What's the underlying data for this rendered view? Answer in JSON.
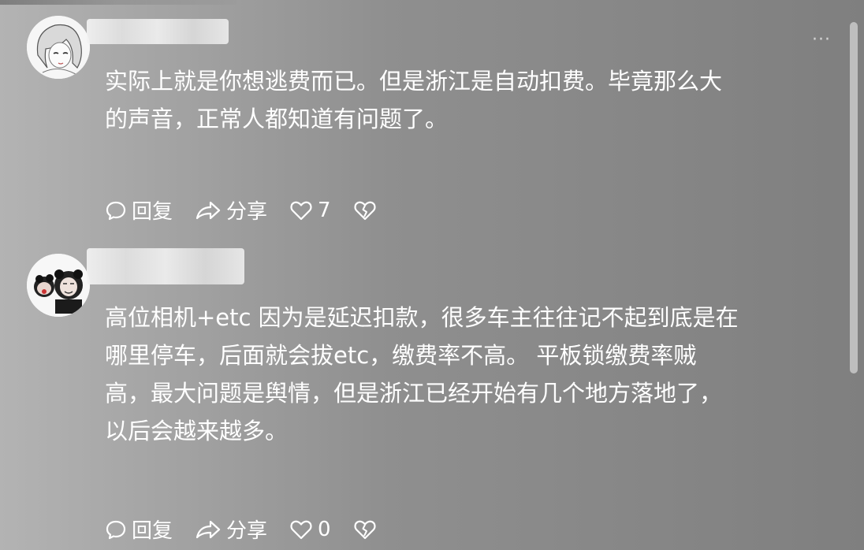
{
  "comments": [
    {
      "lines": [
        "实际上就是你想逃费而已。但是浙江是自动扣费。毕竟那么大",
        "的声音，正常人都知道有问题了。"
      ],
      "reply_label": "回复",
      "share_label": "分享",
      "like_count": "7"
    },
    {
      "lines": [
        "高位相机+etc 因为是延迟扣款，很多车主往往记不起到底是在",
        "哪里停车，后面就会拔etc，缴费率不高。 平板锁缴费率贼",
        "高，最大问题是舆情，但是浙江已经开始有几个地方落地了，",
        "以后会越来越多。"
      ],
      "reply_label": "回复",
      "share_label": "分享",
      "like_count": "0"
    }
  ],
  "icons": {
    "more": "more-dots-icon",
    "reply": "comment-bubble-icon",
    "share": "share-arrow-icon",
    "like": "heart-icon",
    "dislike": "broken-heart-icon"
  },
  "colors": {
    "text": "#ffffff",
    "background": "#8f8f8f"
  }
}
